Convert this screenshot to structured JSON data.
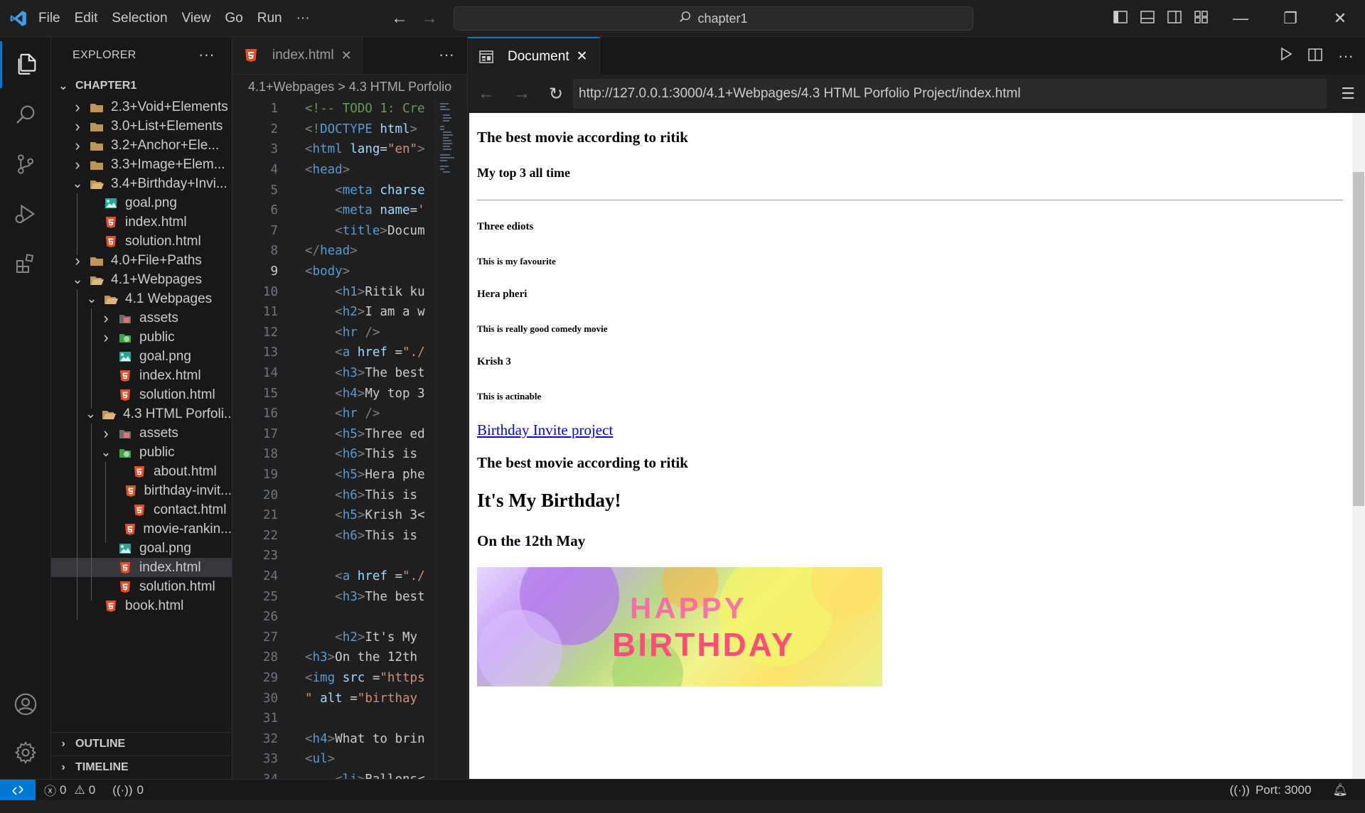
{
  "titlebar": {
    "menu": [
      "File",
      "Edit",
      "Selection",
      "View",
      "Go",
      "Run",
      "···"
    ],
    "search": "chapter1"
  },
  "sidebar": {
    "title": "EXPLORER",
    "more": "···",
    "root": "CHAPTER1",
    "items": [
      {
        "label": "2.3+Void+Elements",
        "type": "folder",
        "depth": 0,
        "open": false
      },
      {
        "label": "3.0+List+Elements",
        "type": "folder",
        "depth": 0,
        "open": false
      },
      {
        "label": "3.2+Anchor+Ele...",
        "type": "folder",
        "depth": 0,
        "open": false
      },
      {
        "label": "3.3+Image+Elem...",
        "type": "folder",
        "depth": 0,
        "open": false
      },
      {
        "label": "3.4+Birthday+Invi...",
        "type": "folder",
        "depth": 0,
        "open": true
      },
      {
        "label": "goal.png",
        "type": "image",
        "depth": 1
      },
      {
        "label": "index.html",
        "type": "html",
        "depth": 1
      },
      {
        "label": "solution.html",
        "type": "html",
        "depth": 1
      },
      {
        "label": "4.0+File+Paths",
        "type": "folder",
        "depth": 0,
        "open": false
      },
      {
        "label": "4.1+Webpages",
        "type": "folder",
        "depth": 0,
        "open": true
      },
      {
        "label": "4.1 Webpages",
        "type": "folder",
        "depth": 1,
        "open": true
      },
      {
        "label": "assets",
        "type": "assets",
        "depth": 2,
        "open": false
      },
      {
        "label": "public",
        "type": "public",
        "depth": 2,
        "open": false
      },
      {
        "label": "goal.png",
        "type": "image",
        "depth": 2
      },
      {
        "label": "index.html",
        "type": "html",
        "depth": 2
      },
      {
        "label": "solution.html",
        "type": "html",
        "depth": 2
      },
      {
        "label": "4.3 HTML Porfoli...",
        "type": "folder",
        "depth": 1,
        "open": true
      },
      {
        "label": "assets",
        "type": "assets",
        "depth": 2,
        "open": false
      },
      {
        "label": "public",
        "type": "public",
        "depth": 2,
        "open": true
      },
      {
        "label": "about.html",
        "type": "html",
        "depth": 3
      },
      {
        "label": "birthday-invit...",
        "type": "html",
        "depth": 3
      },
      {
        "label": "contact.html",
        "type": "html",
        "depth": 3
      },
      {
        "label": "movie-rankin...",
        "type": "html",
        "depth": 3
      },
      {
        "label": "goal.png",
        "type": "image",
        "depth": 2
      },
      {
        "label": "index.html",
        "type": "html",
        "depth": 2,
        "selected": true
      },
      {
        "label": "solution.html",
        "type": "html",
        "depth": 2
      },
      {
        "label": "book.html",
        "type": "html",
        "depth": 1
      }
    ],
    "outline": "OUTLINE",
    "timeline": "TIMELINE"
  },
  "editor": {
    "tab_label": "index.html",
    "more": "···",
    "breadcrumb": "4.1+Webpages > 4.3 HTML Porfolio",
    "current_line": 9,
    "lines": [
      {
        "n": "1",
        "parts": [
          [
            "c-com",
            "<!-- TODO 1: Cre"
          ]
        ]
      },
      {
        "n": "2",
        "parts": [
          [
            "c-br",
            "<!"
          ],
          [
            "c-tag",
            "DOCTYPE"
          ],
          [
            "c-txt",
            " "
          ],
          [
            "c-attr",
            "html"
          ],
          [
            "c-br",
            ">"
          ]
        ]
      },
      {
        "n": "3",
        "parts": [
          [
            "c-br",
            "<"
          ],
          [
            "c-tag",
            "html"
          ],
          [
            "c-txt",
            " "
          ],
          [
            "c-attr",
            "lang"
          ],
          [
            "c-txt",
            "="
          ],
          [
            "c-str",
            "\"en\""
          ],
          [
            "c-br",
            ">"
          ]
        ]
      },
      {
        "n": "4",
        "parts": [
          [
            "c-br",
            "<"
          ],
          [
            "c-tag",
            "head"
          ],
          [
            "c-br",
            ">"
          ]
        ]
      },
      {
        "n": "5",
        "parts": [
          [
            "c-txt",
            "    "
          ],
          [
            "c-br",
            "<"
          ],
          [
            "c-tag",
            "meta"
          ],
          [
            "c-txt",
            " "
          ],
          [
            "c-attr",
            "charse"
          ]
        ]
      },
      {
        "n": "6",
        "parts": [
          [
            "c-txt",
            "    "
          ],
          [
            "c-br",
            "<"
          ],
          [
            "c-tag",
            "meta"
          ],
          [
            "c-txt",
            " "
          ],
          [
            "c-attr",
            "name"
          ],
          [
            "c-txt",
            "="
          ],
          [
            "c-str",
            "'"
          ]
        ]
      },
      {
        "n": "7",
        "parts": [
          [
            "c-txt",
            "    "
          ],
          [
            "c-br",
            "<"
          ],
          [
            "c-tag",
            "title"
          ],
          [
            "c-br",
            ">"
          ],
          [
            "c-txt",
            "Docum"
          ]
        ]
      },
      {
        "n": "8",
        "parts": [
          [
            "c-br",
            "</"
          ],
          [
            "c-tag",
            "head"
          ],
          [
            "c-br",
            ">"
          ]
        ]
      },
      {
        "n": "9",
        "parts": [
          [
            "c-br",
            "<"
          ],
          [
            "c-tag",
            "body"
          ],
          [
            "c-br",
            ">"
          ]
        ]
      },
      {
        "n": "10",
        "parts": [
          [
            "c-txt",
            "    "
          ],
          [
            "c-br",
            "<"
          ],
          [
            "c-tag",
            "h1"
          ],
          [
            "c-br",
            ">"
          ],
          [
            "c-txt",
            "Ritik ku"
          ]
        ]
      },
      {
        "n": "11",
        "parts": [
          [
            "c-txt",
            "    "
          ],
          [
            "c-br",
            "<"
          ],
          [
            "c-tag",
            "h2"
          ],
          [
            "c-br",
            ">"
          ],
          [
            "c-txt",
            "I am a w"
          ]
        ]
      },
      {
        "n": "12",
        "parts": [
          [
            "c-txt",
            "    "
          ],
          [
            "c-br",
            "<"
          ],
          [
            "c-tag",
            "hr"
          ],
          [
            "c-txt",
            " "
          ],
          [
            "c-br",
            "/>"
          ]
        ]
      },
      {
        "n": "13",
        "parts": [
          [
            "c-txt",
            "    "
          ],
          [
            "c-br",
            "<"
          ],
          [
            "c-tag",
            "a"
          ],
          [
            "c-txt",
            " "
          ],
          [
            "c-attr",
            "href"
          ],
          [
            "c-txt",
            " ="
          ],
          [
            "c-str",
            "\"./"
          ]
        ]
      },
      {
        "n": "14",
        "parts": [
          [
            "c-txt",
            "    "
          ],
          [
            "c-br",
            "<"
          ],
          [
            "c-tag",
            "h3"
          ],
          [
            "c-br",
            ">"
          ],
          [
            "c-txt",
            "The best"
          ]
        ]
      },
      {
        "n": "15",
        "parts": [
          [
            "c-txt",
            "    "
          ],
          [
            "c-br",
            "<"
          ],
          [
            "c-tag",
            "h4"
          ],
          [
            "c-br",
            ">"
          ],
          [
            "c-txt",
            "My top 3"
          ]
        ]
      },
      {
        "n": "16",
        "parts": [
          [
            "c-txt",
            "    "
          ],
          [
            "c-br",
            "<"
          ],
          [
            "c-tag",
            "hr"
          ],
          [
            "c-txt",
            " "
          ],
          [
            "c-br",
            "/>"
          ]
        ]
      },
      {
        "n": "17",
        "parts": [
          [
            "c-txt",
            "    "
          ],
          [
            "c-br",
            "<"
          ],
          [
            "c-tag",
            "h5"
          ],
          [
            "c-br",
            ">"
          ],
          [
            "c-txt",
            "Three ed"
          ]
        ]
      },
      {
        "n": "18",
        "parts": [
          [
            "c-txt",
            "    "
          ],
          [
            "c-br",
            "<"
          ],
          [
            "c-tag",
            "h6"
          ],
          [
            "c-br",
            ">"
          ],
          [
            "c-txt",
            "This is "
          ]
        ]
      },
      {
        "n": "19",
        "parts": [
          [
            "c-txt",
            "    "
          ],
          [
            "c-br",
            "<"
          ],
          [
            "c-tag",
            "h5"
          ],
          [
            "c-br",
            ">"
          ],
          [
            "c-txt",
            "Hera phe"
          ]
        ]
      },
      {
        "n": "20",
        "parts": [
          [
            "c-txt",
            "    "
          ],
          [
            "c-br",
            "<"
          ],
          [
            "c-tag",
            "h6"
          ],
          [
            "c-br",
            ">"
          ],
          [
            "c-txt",
            "This is "
          ]
        ]
      },
      {
        "n": "21",
        "parts": [
          [
            "c-txt",
            "    "
          ],
          [
            "c-br",
            "<"
          ],
          [
            "c-tag",
            "h5"
          ],
          [
            "c-br",
            ">"
          ],
          [
            "c-txt",
            "Krish 3<"
          ]
        ]
      },
      {
        "n": "22",
        "parts": [
          [
            "c-txt",
            "    "
          ],
          [
            "c-br",
            "<"
          ],
          [
            "c-tag",
            "h6"
          ],
          [
            "c-br",
            ">"
          ],
          [
            "c-txt",
            "This is "
          ]
        ]
      },
      {
        "n": "23",
        "parts": []
      },
      {
        "n": "24",
        "parts": [
          [
            "c-txt",
            "    "
          ],
          [
            "c-br",
            "<"
          ],
          [
            "c-tag",
            "a"
          ],
          [
            "c-txt",
            " "
          ],
          [
            "c-attr",
            "href"
          ],
          [
            "c-txt",
            " ="
          ],
          [
            "c-str",
            "\"./"
          ]
        ]
      },
      {
        "n": "25",
        "parts": [
          [
            "c-txt",
            "    "
          ],
          [
            "c-br",
            "<"
          ],
          [
            "c-tag",
            "h3"
          ],
          [
            "c-br",
            ">"
          ],
          [
            "c-txt",
            "The best"
          ]
        ]
      },
      {
        "n": "26",
        "parts": []
      },
      {
        "n": "27",
        "parts": [
          [
            "c-txt",
            "    "
          ],
          [
            "c-br",
            "<"
          ],
          [
            "c-tag",
            "h2"
          ],
          [
            "c-br",
            ">"
          ],
          [
            "c-txt",
            "It's My "
          ]
        ]
      },
      {
        "n": "28",
        "parts": [
          [
            "c-br",
            "<"
          ],
          [
            "c-tag",
            "h3"
          ],
          [
            "c-br",
            ">"
          ],
          [
            "c-txt",
            "On the 12th "
          ]
        ]
      },
      {
        "n": "29",
        "parts": [
          [
            "c-br",
            "<"
          ],
          [
            "c-tag",
            "img"
          ],
          [
            "c-txt",
            " "
          ],
          [
            "c-attr",
            "src"
          ],
          [
            "c-txt",
            " ="
          ],
          [
            "c-str",
            "\"https"
          ]
        ]
      },
      {
        "n": "30",
        "parts": [
          [
            "c-str",
            "\""
          ],
          [
            "c-txt",
            " "
          ],
          [
            "c-attr",
            "alt"
          ],
          [
            "c-txt",
            " ="
          ],
          [
            "c-str",
            "\"birthay "
          ]
        ]
      },
      {
        "n": "31",
        "parts": []
      },
      {
        "n": "32",
        "parts": [
          [
            "c-br",
            "<"
          ],
          [
            "c-tag",
            "h4"
          ],
          [
            "c-br",
            ">"
          ],
          [
            "c-txt",
            "What to brin"
          ]
        ]
      },
      {
        "n": "33",
        "parts": [
          [
            "c-br",
            "<"
          ],
          [
            "c-tag",
            "ul"
          ],
          [
            "c-br",
            ">"
          ]
        ]
      },
      {
        "n": "34",
        "parts": [
          [
            "c-txt",
            "    "
          ],
          [
            "c-br",
            "<"
          ],
          [
            "c-tag",
            "li"
          ],
          [
            "c-br",
            ">"
          ],
          [
            "c-txt",
            "Ballons<"
          ]
        ]
      }
    ]
  },
  "browser": {
    "tab_label": "Document",
    "url": "http://127.0.0.1:3000/4.1+Webpages/4.3 HTML Porfolio Project/index.html",
    "page": {
      "h3_best_movie": "The best movie according to ritik",
      "h4_top3": "My top 3 all time",
      "h5_three_ediots": "Three ediots",
      "h6_favourite": "This is my favourite",
      "h5_hera_pheri": "Hera pheri",
      "h6_comedy": "This is really good comedy movie",
      "h5_krish": "Krish 3",
      "h6_actinable": "This is actinable",
      "link_birthday": "Birthday Invite project",
      "h3_best_movie_2": "The best movie according to ritik",
      "h2_birthday": "It's My Birthday!",
      "h3_date": "On the 12th May"
    }
  },
  "statusbar": {
    "errors": "0",
    "warnings": "0",
    "ports_count": "0",
    "port": "Port: 3000"
  },
  "colors": {
    "accent": "#0078d4",
    "html_icon": "#e44d26",
    "link": "#0000ee"
  }
}
